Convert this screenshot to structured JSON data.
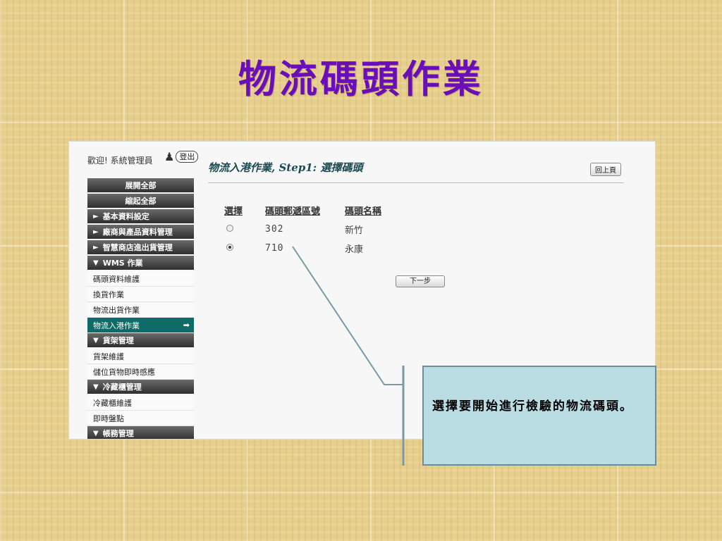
{
  "slide": {
    "title": "物流碼頭作業"
  },
  "app": {
    "welcome_text": "歡迎! 系統管理員",
    "logout_label": "登出",
    "content_title": "物流入港作業, Step1: 選擇碼頭",
    "back_label": "回上頁",
    "next_label": "下一步"
  },
  "sidebar": {
    "expand_all": "展開全部",
    "collapse_all": "縮起全部",
    "sections": [
      {
        "label": "基本資料設定",
        "marker": "►",
        "items": []
      },
      {
        "label": "廠商與產品資料管理",
        "marker": "►",
        "items": []
      },
      {
        "label": "智慧商店進出貨管理",
        "marker": "►",
        "items": []
      },
      {
        "label": "WMS 作業",
        "marker": "▼",
        "items": [
          "碼頭資料維護",
          "換貨作業",
          "物流出貨作業",
          "物流入港作業"
        ]
      },
      {
        "label": "貨架管理",
        "marker": "▼",
        "items": [
          "貨架維護",
          "儲位貨物即時感應"
        ]
      },
      {
        "label": "冷藏櫃管理",
        "marker": "▼",
        "items": [
          "冷藏櫃維護",
          "即時盤點"
        ]
      },
      {
        "label": "帳務管理",
        "marker": "▼",
        "items": []
      }
    ],
    "active_item": "物流入港作業"
  },
  "table": {
    "headers": [
      "選擇",
      "碼頭郵遞區號",
      "碼頭名稱"
    ],
    "rows": [
      {
        "zip": "302",
        "name": "新竹",
        "selected": false
      },
      {
        "zip": "710",
        "name": "永康",
        "selected": true
      }
    ]
  },
  "callout": {
    "text": "選擇要開始進行檢驗的物流碼頭。"
  }
}
